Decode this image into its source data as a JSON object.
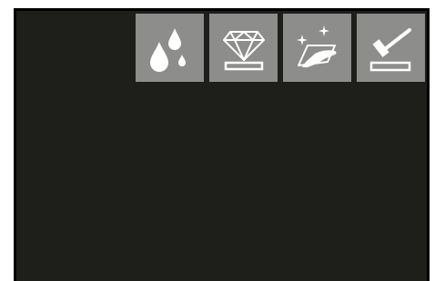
{
  "colors": {
    "page_background": "#ffffff",
    "panel_background": "#1e1f1b",
    "panel_border": "#000000",
    "tile_background": "#8d8d8b",
    "icon_color": "#ffffff"
  },
  "toolbar": {
    "tiles": [
      {
        "icon": "water-drops-icon"
      },
      {
        "icon": "diamond-on-plate-icon"
      },
      {
        "icon": "sparkling-glass-hand-icon"
      },
      {
        "icon": "hammer-on-block-icon"
      }
    ]
  }
}
